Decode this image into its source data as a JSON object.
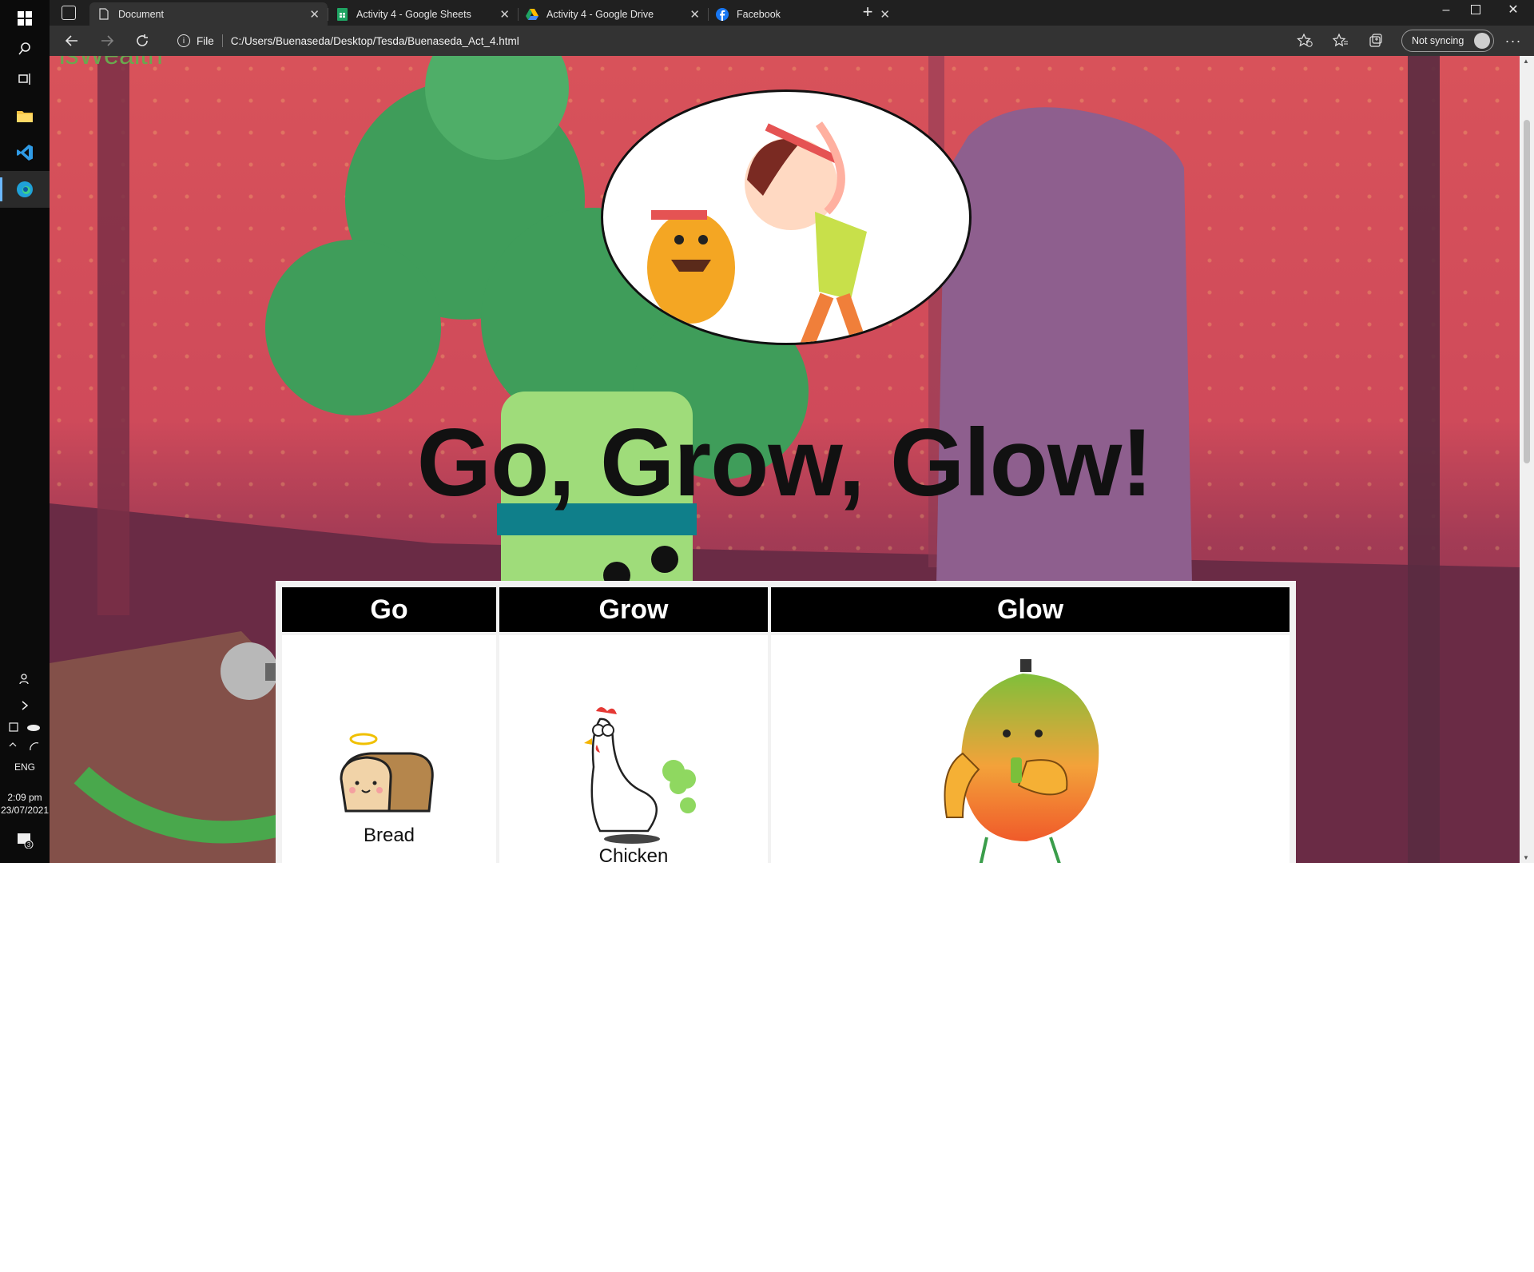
{
  "taskbar": {
    "language": "ENG",
    "time": "2:09 pm",
    "date": "23/07/2021",
    "notifications_count": "3"
  },
  "browser": {
    "tabs": [
      {
        "title": "Document",
        "icon": "page-icon",
        "active": true
      },
      {
        "title": "Activity 4 - Google Sheets",
        "icon": "google-sheets-icon",
        "active": false
      },
      {
        "title": "Activity 4 - Google Drive",
        "icon": "google-drive-icon",
        "active": false
      },
      {
        "title": "Facebook",
        "icon": "facebook-icon",
        "active": false
      }
    ],
    "address_scheme": "File",
    "address_url": "C:/Users/Buenaseda/Desktop/Tesda/Buenaseda_Act_4.html",
    "sync_label": "Not syncing"
  },
  "page": {
    "corner_text": "isWealth",
    "title": "Go, Grow, Glow!",
    "table": {
      "headers": [
        "Go",
        "Grow",
        "Glow"
      ],
      "items": [
        "Bread",
        "Chicken",
        ""
      ]
    }
  },
  "colors": {
    "header_bg": "#000000",
    "header_text": "#ffffff",
    "background_red": "#d8525a",
    "chrome_dark": "#202020"
  }
}
